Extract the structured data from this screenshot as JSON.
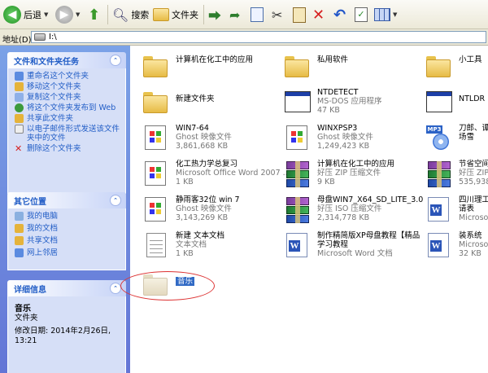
{
  "toolbar": {
    "back_label": "后退",
    "search_label": "搜索",
    "folders_label": "文件夹"
  },
  "address": {
    "label": "地址(D)",
    "path": "I:\\"
  },
  "left": {
    "tasks_title": "文件和文件夹任务",
    "tasks": [
      "重命名这个文件夹",
      "移动这个文件夹",
      "复制这个文件夹",
      "将这个文件夹发布到 Web",
      "共享此文件夹",
      "以电子邮件形式发送该文件夹中的文件",
      "删除这个文件夹"
    ],
    "other_title": "其它位置",
    "other": [
      "我的电脑",
      "我的文档",
      "共享文档",
      "网上邻居"
    ],
    "details_title": "详细信息",
    "details": {
      "name": "音乐",
      "type": "文件夹",
      "modified": "修改日期: 2014年2月26日, 13:21"
    }
  },
  "files": [
    {
      "name": "计算机在化工中的应用",
      "line2": "",
      "line3": "",
      "icon": "folder-icon"
    },
    {
      "name": "私用软件",
      "line2": "",
      "line3": "",
      "icon": "folder-icon"
    },
    {
      "name": "小工具",
      "line2": "",
      "line3": "",
      "icon": "folder-icon"
    },
    {
      "name": "新建文件夹",
      "line2": "",
      "line3": "",
      "icon": "folder-icon"
    },
    {
      "name": "NTDETECT",
      "line2": "MS-DOS 应用程序",
      "line3": "47 KB",
      "icon": "window-icon"
    },
    {
      "name": "NTLDR",
      "line2": "",
      "line3": "",
      "icon": "window-icon"
    },
    {
      "name": "WIN7-64",
      "line2": "Ghost 映像文件",
      "line3": "3,861,668 KB",
      "icon": "ghost-image-icon"
    },
    {
      "name": "WINXPSP3",
      "line2": "Ghost 映像文件",
      "line3": "1,249,423 KB",
      "icon": "ghost-image-icon"
    },
    {
      "name": "刀郎、谭",
      "line2": "场雪",
      "line3": "",
      "icon": "mp3-icon"
    },
    {
      "name": "化工热力学总复习",
      "line2": "Microsoft Office Word 2007 ...",
      "line3": "1 KB",
      "icon": "ghost-image-icon"
    },
    {
      "name": "计算机在化工中的应用",
      "line2": "好压 ZIP 压缩文件",
      "line3": "9 KB",
      "icon": "rar-icon"
    },
    {
      "name": "节省空间",
      "line2": "好压 ZIP",
      "line3": "535,938",
      "icon": "rar-icon"
    },
    {
      "name": "静雨客32位 win 7",
      "line2": "Ghost 映像文件",
      "line3": "3,143,269 KB",
      "icon": "ghost-image-icon"
    },
    {
      "name": "母盘WIN7_X64_SD_LITE_3.0",
      "line2": "好压 ISO 压缩文件",
      "line3": "2,314,778 KB",
      "icon": "rar-icon"
    },
    {
      "name": "四川理工",
      "line2": "请表",
      "line3": "Microsoft",
      "icon": "word-icon"
    },
    {
      "name": "新建 文本文档",
      "line2": "文本文档",
      "line3": "1 KB",
      "icon": "text-doc-icon"
    },
    {
      "name": "制作精简版XP母盘教程【精品",
      "line2": "学习教程",
      "line3": "Microsoft Word 文档",
      "icon": "word-icon"
    },
    {
      "name": "装系统",
      "line2": "Microsoft",
      "line3": "32 KB",
      "icon": "word-icon"
    },
    {
      "name": "音乐",
      "line2": "",
      "line3": "",
      "icon": "folder-icon"
    }
  ]
}
